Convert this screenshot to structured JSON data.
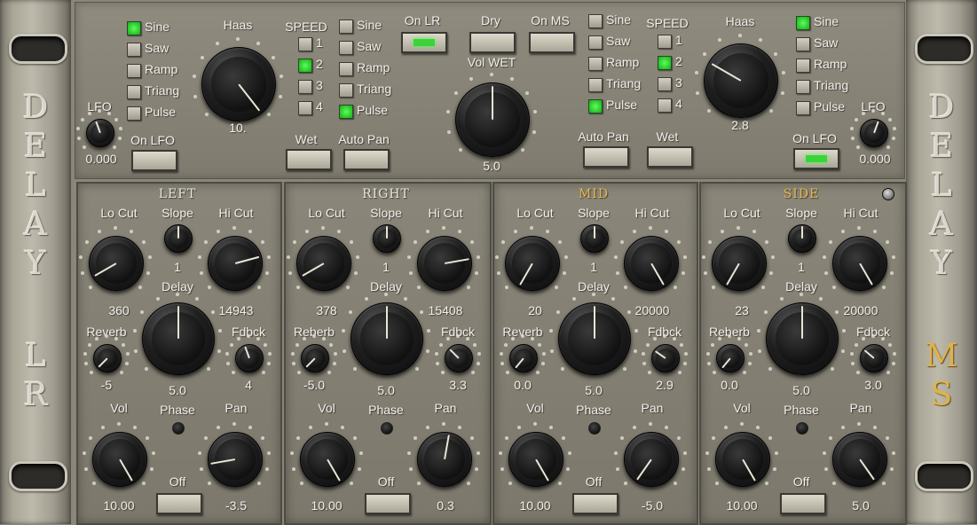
{
  "rack": {
    "left_word": [
      "D",
      "E",
      "L",
      "A",
      "Y"
    ],
    "left_mode": [
      "L",
      "R"
    ],
    "right_word": [
      "D",
      "E",
      "L",
      "A",
      "Y"
    ],
    "right_mode": [
      "M",
      "S"
    ]
  },
  "top": {
    "left": {
      "lfo_shapes": [
        {
          "label": "Sine",
          "on": true
        },
        {
          "label": "Saw",
          "on": false
        },
        {
          "label": "Ramp",
          "on": false
        },
        {
          "label": "Triang",
          "on": false
        },
        {
          "label": "Pulse",
          "on": false
        }
      ],
      "haas_label": "Haas",
      "haas_value": "10.",
      "lfo_label": "LFO",
      "lfo_value": "0.000",
      "on_lfo_label": "On LFO",
      "speed_label": "SPEED",
      "speeds": [
        {
          "label": "1",
          "on": false
        },
        {
          "label": "2",
          "on": true
        },
        {
          "label": "3",
          "on": false
        },
        {
          "label": "4",
          "on": false
        }
      ],
      "pan_shapes": [
        {
          "label": "Sine",
          "on": false
        },
        {
          "label": "Saw",
          "on": false
        },
        {
          "label": "Ramp",
          "on": false
        },
        {
          "label": "Triang",
          "on": false
        },
        {
          "label": "Pulse",
          "on": true
        }
      ],
      "wet_label": "Wet",
      "auto_pan_label": "Auto Pan"
    },
    "center": {
      "on_lr_label": "On LR",
      "dry_label": "Dry",
      "on_ms_label": "On MS",
      "vol_wet_label": "Vol WET",
      "vol_wet_value": "5.0"
    },
    "right": {
      "pan_shapes": [
        {
          "label": "Sine",
          "on": false
        },
        {
          "label": "Saw",
          "on": false
        },
        {
          "label": "Ramp",
          "on": false
        },
        {
          "label": "Triang",
          "on": false
        },
        {
          "label": "Pulse",
          "on": true
        }
      ],
      "speed_label": "SPEED",
      "speeds": [
        {
          "label": "1",
          "on": false
        },
        {
          "label": "2",
          "on": true
        },
        {
          "label": "3",
          "on": false
        },
        {
          "label": "4",
          "on": false
        }
      ],
      "haas_label": "Haas",
      "haas_value": "2.8",
      "lfo_shapes": [
        {
          "label": "Sine",
          "on": true
        },
        {
          "label": "Saw",
          "on": false
        },
        {
          "label": "Ramp",
          "on": false
        },
        {
          "label": "Triang",
          "on": false
        },
        {
          "label": "Pulse",
          "on": false
        }
      ],
      "lfo_label": "LFO",
      "lfo_value": "0.000",
      "on_lfo_label": "On LFO",
      "auto_pan_label": "Auto Pan",
      "wet_label": "Wet"
    }
  },
  "channels": [
    {
      "title": "LEFT",
      "gold": false,
      "lo_cut_label": "Lo Cut",
      "lo_cut": "360",
      "slope_label": "Slope",
      "slope": "1",
      "hi_cut_label": "Hi Cut",
      "hi_cut": "14943",
      "delay_label": "Delay",
      "delay": "5.0",
      "reverb_label": "Reverb",
      "reverb": "-5",
      "fdbck_label": "Fdbck",
      "fdbck": "4",
      "vol_label": "Vol",
      "vol": "10.00",
      "phase_label": "Phase",
      "phase_btn": "Off",
      "pan_label": "Pan",
      "pan": "-3.5"
    },
    {
      "title": "RIGHT",
      "gold": false,
      "lo_cut_label": "Lo Cut",
      "lo_cut": "378",
      "slope_label": "Slope",
      "slope": "1",
      "hi_cut_label": "Hi Cut",
      "hi_cut": "15408",
      "delay_label": "Delay",
      "delay": "5.0",
      "reverb_label": "Reberb",
      "reverb": "-5.0",
      "fdbck_label": "Fdbck",
      "fdbck": "3.3",
      "vol_label": "Vol",
      "vol": "10.00",
      "phase_label": "Phase",
      "phase_btn": "Off",
      "pan_label": "Pan",
      "pan": "0.3"
    },
    {
      "title": "MID",
      "gold": true,
      "lo_cut_label": "Lo Cut",
      "lo_cut": "20",
      "slope_label": "Slope",
      "slope": "1",
      "hi_cut_label": "Hi Cut",
      "hi_cut": "20000",
      "delay_label": "Delay",
      "delay": "5.0",
      "reverb_label": "Reverb",
      "reverb": "0.0",
      "fdbck_label": "Fdbck",
      "fdbck": "2.9",
      "vol_label": "Vol",
      "vol": "10.00",
      "phase_label": "Phase",
      "phase_btn": "Off",
      "pan_label": "Pan",
      "pan": "-5.0"
    },
    {
      "title": "SIDE",
      "gold": true,
      "lo_cut_label": "Lo Cut",
      "lo_cut": "23",
      "slope_label": "Slope",
      "slope": "1",
      "hi_cut_label": "Hi Cut",
      "hi_cut": "20000",
      "delay_label": "Delay",
      "delay": "5.0",
      "reverb_label": "Reberb",
      "reverb": "0.0",
      "fdbck_label": "Fdbck",
      "fdbck": "3.0",
      "vol_label": "Vol",
      "vol": "10.00",
      "phase_label": "Phase",
      "phase_btn": "Off",
      "pan_label": "Pan",
      "pan": "5.0"
    }
  ],
  "colors": {
    "led_green": "#3ad43a",
    "gold": "#e0b24a",
    "panel": "#8a8679"
  }
}
